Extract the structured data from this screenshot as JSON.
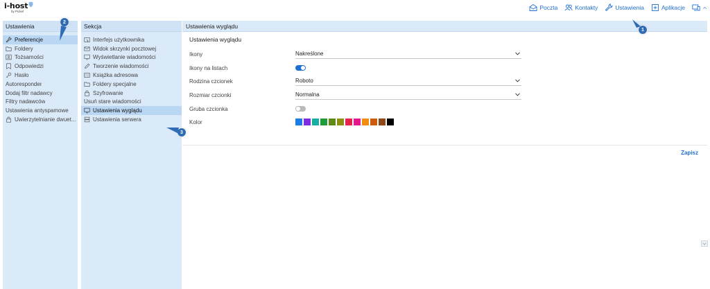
{
  "app": {
    "logo_main": "i-host",
    "logo_sub": "by Pickel"
  },
  "topnav": {
    "items": [
      {
        "label": "Poczta",
        "icon": "envelope-open-icon"
      },
      {
        "label": "Kontakty",
        "icon": "contacts-icon"
      },
      {
        "label": "Ustawienia",
        "icon": "wrench-icon"
      },
      {
        "label": "Aplikacje",
        "icon": "plus-square-icon"
      },
      {
        "label": "",
        "icon": "devices-icon"
      }
    ]
  },
  "col1": {
    "header": "Ustawienia",
    "items": [
      {
        "label": "Preferencje",
        "icon": "wrench-icon",
        "active": true
      },
      {
        "label": "Foldery",
        "icon": "folder-icon"
      },
      {
        "label": "Tożsamości",
        "icon": "id-card-icon"
      },
      {
        "label": "Odpowiedzi",
        "icon": "note-icon"
      },
      {
        "label": "Hasło",
        "icon": "key-icon"
      },
      {
        "label": "Autoresponder"
      },
      {
        "label": "Dodaj filtr nadawcy"
      },
      {
        "label": "Filtry nadawców"
      },
      {
        "label": "Ustawienia antyspamowe"
      },
      {
        "label": "Uwierzytelnianie dwuet...",
        "icon": "lock-icon"
      }
    ]
  },
  "col2": {
    "header": "Sekcja",
    "items": [
      {
        "label": "Interfejs użytkownika",
        "icon": "interface-icon"
      },
      {
        "label": "Widok skrzynki pocztowej",
        "icon": "envelope-icon"
      },
      {
        "label": "Wyświetlanie wiadomości",
        "icon": "monitor-icon"
      },
      {
        "label": "Tworzenie wiadomości",
        "icon": "pencil-icon"
      },
      {
        "label": "Książka adresowa",
        "icon": "address-book-icon"
      },
      {
        "label": "Foldery specjalne",
        "icon": "folder-icon"
      },
      {
        "label": "Szyfrowanie",
        "icon": "lock-icon"
      },
      {
        "label": "Usuń stare wiadomości"
      },
      {
        "label": "Ustawienia wyglądu",
        "icon": "monitor-icon",
        "active": true
      },
      {
        "label": "Ustawienia serwera",
        "icon": "server-icon"
      }
    ]
  },
  "main": {
    "header": "Ustawienia wyglądu",
    "section_title": "Ustawienia wyglądu",
    "rows": {
      "icons": {
        "label": "Ikony",
        "value": "Nakreślone"
      },
      "list_icons": {
        "label": "Ikony na listach",
        "on": true
      },
      "font_family": {
        "label": "Rodzina czcionek",
        "value": "Roboto"
      },
      "font_size": {
        "label": "Rozmiar czcionki",
        "value": "Normalna"
      },
      "bold_font": {
        "label": "Gruba czcionka",
        "on": false
      },
      "color": {
        "label": "Kolor"
      }
    },
    "swatches": [
      "#1e7be6",
      "#7b2fe0",
      "#1aaea2",
      "#1f9a39",
      "#5f8a17",
      "#8e8e12",
      "#e6254d",
      "#e0198e",
      "#f08c12",
      "#c85c0c",
      "#8b4a17",
      "#000000"
    ],
    "save_label": "Zapisz"
  },
  "badges": [
    "1",
    "2",
    "3"
  ],
  "colors": {
    "accent": "#1f6fd1",
    "panel": "#dbeaf8",
    "panel_active": "#b9d6f3",
    "badge": "#2f6cb5"
  }
}
